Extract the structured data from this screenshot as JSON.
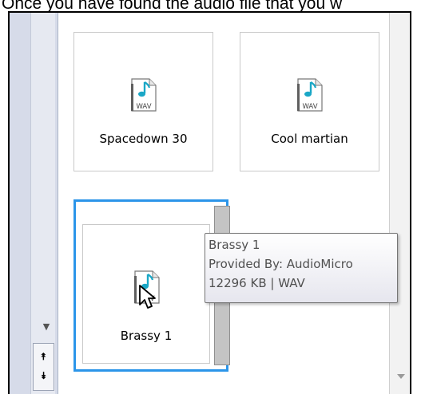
{
  "caption": {
    "text": "Once you have found the audio file that you w"
  },
  "items": [
    {
      "label": "Spacedown 30",
      "icon": "wav-file-icon",
      "icon_text": "WAV"
    },
    {
      "label": "Cool martian",
      "icon": "wav-file-icon",
      "icon_text": "WAV"
    },
    {
      "label": "Brassy 1",
      "icon": "wav-file-icon",
      "icon_text": "WAV",
      "selected": true
    }
  ],
  "tooltip": {
    "title": "Brassy 1",
    "provider": "Provided By: AudioMicro",
    "details": "12296 KB | WAV"
  },
  "icons": {
    "scroll_down": "triangle-down-icon",
    "scroll_up_double": "double-up-arrow-icon",
    "scroll_down_double": "double-down-arrow-icon"
  },
  "colors": {
    "selection": "#2b95e9",
    "note": "#1aa7c6",
    "strip": "#d6dbe9"
  }
}
